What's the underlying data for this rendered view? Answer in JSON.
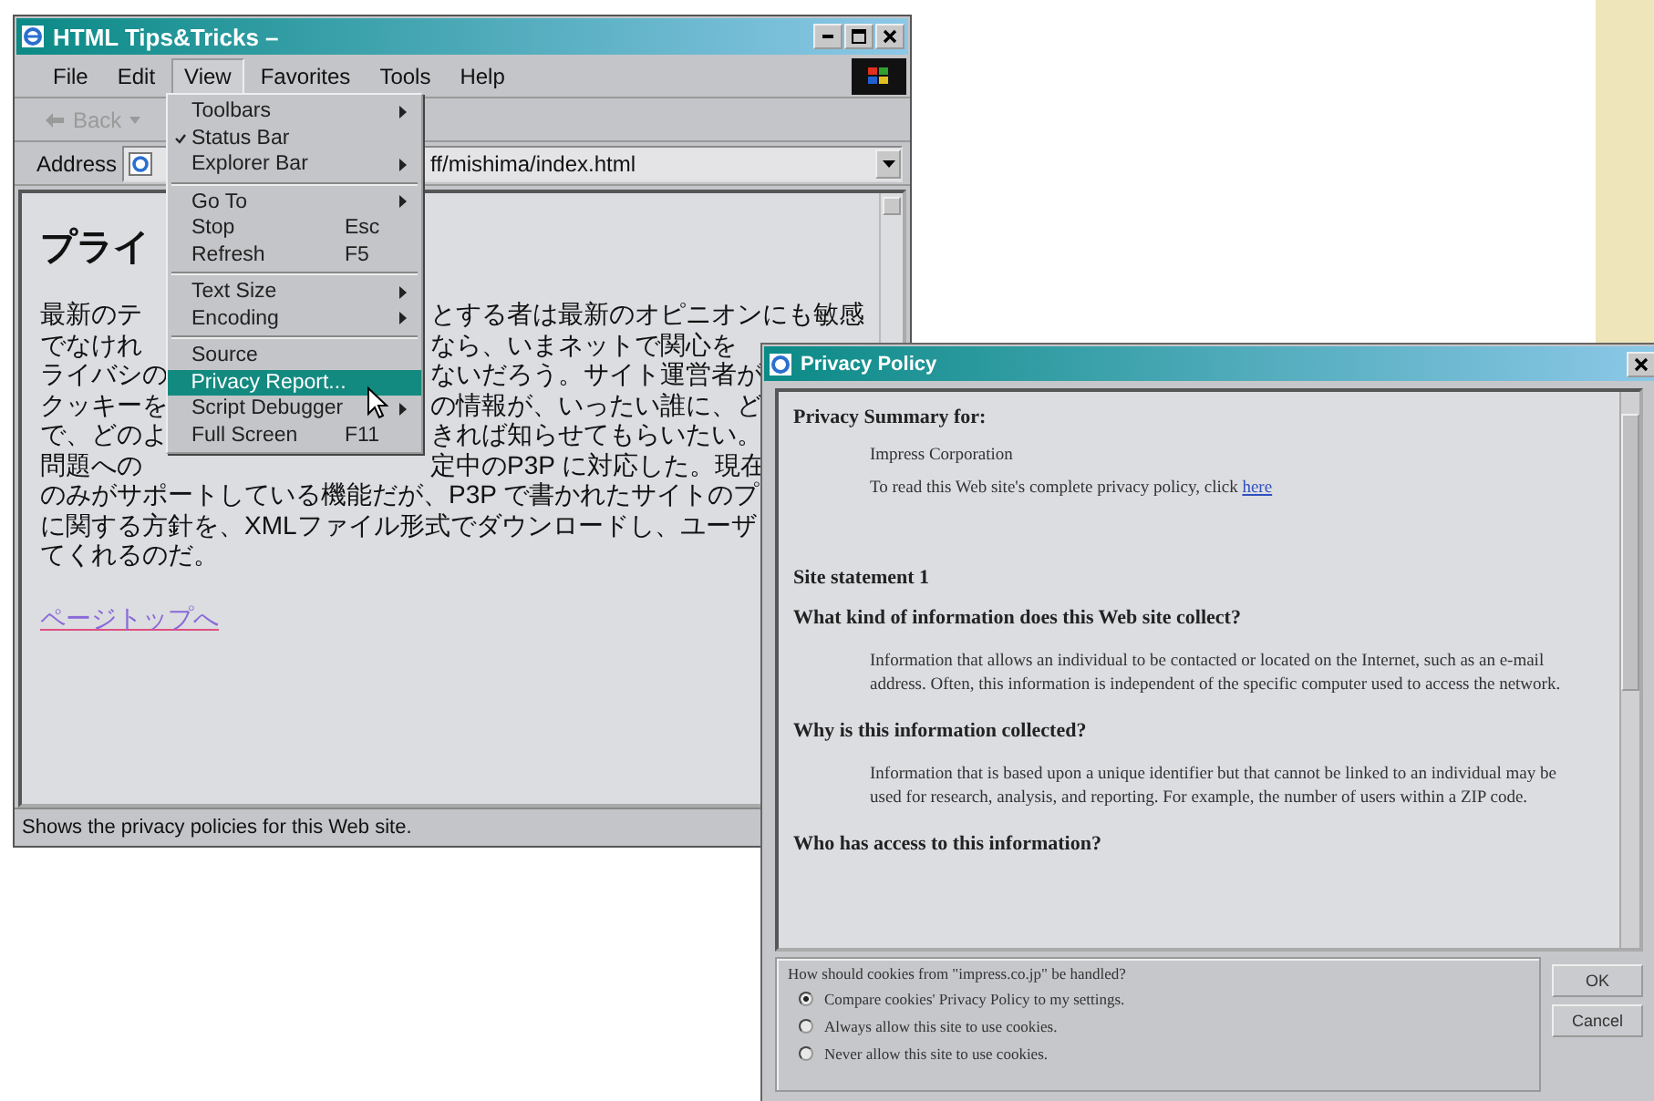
{
  "browser_window": {
    "title": "HTML Tips&Tricks –",
    "menu_bar": [
      {
        "label": "File",
        "selected": false
      },
      {
        "label": "Edit",
        "selected": false
      },
      {
        "label": "View",
        "selected": true
      },
      {
        "label": "Favorites",
        "selected": false
      },
      {
        "label": "Tools",
        "selected": false
      },
      {
        "label": "Help",
        "selected": false
      }
    ],
    "toolbar": {
      "back_label": "Back",
      "disabled": true
    },
    "address": {
      "label": "Address",
      "value": "ff/mishima/index.html"
    },
    "view_menu": [
      [
        {
          "label": "Toolbars",
          "submenu": true,
          "checked": false,
          "selected": false
        },
        {
          "label": "Status Bar",
          "submenu": false,
          "checked": true,
          "selected": false
        },
        {
          "label": "Explorer Bar",
          "submenu": true,
          "checked": false,
          "selected": false
        }
      ],
      [
        {
          "label": "Go To",
          "submenu": true,
          "checked": false,
          "selected": false
        },
        {
          "label": "Stop",
          "shortcut": "Esc",
          "submenu": false,
          "checked": false,
          "selected": false
        },
        {
          "label": "Refresh",
          "shortcut": "F5",
          "submenu": false,
          "checked": false,
          "selected": false
        }
      ],
      [
        {
          "label": "Text Size",
          "submenu": true,
          "checked": false,
          "selected": false
        },
        {
          "label": "Encoding",
          "submenu": true,
          "checked": false,
          "selected": false
        }
      ],
      [
        {
          "label": "Source",
          "submenu": false,
          "checked": false,
          "selected": false
        },
        {
          "label": "Privacy Report...",
          "submenu": false,
          "checked": false,
          "selected": true
        },
        {
          "label": "Script Debugger",
          "submenu": true,
          "checked": false,
          "selected": false
        },
        {
          "label": "Full Screen",
          "shortcut": "F11",
          "submenu": false,
          "checked": false,
          "selected": false
        }
      ]
    ],
    "page": {
      "heading": "プライ",
      "lines": [
        {
          "left": "最新のテ",
          "right": "とする者は最新のオピニオンにも敏感"
        },
        {
          "left": "でなけれ",
          "right": "なら、いまネットで関心を"
        },
        {
          "left": "ライバシの",
          "right": "ないだろう。サイト運営者が"
        },
        {
          "left": "クッキーを",
          "right": "の情報が、いったい誰に、ど"
        },
        {
          "left": "で、どのよ",
          "right": "きれば知らせてもらいたい。"
        },
        {
          "left": "問題への",
          "right": "定中のP3P に対応した。現在"
        },
        {
          "left": "のみがサポートしている機能だが、P3P で書かれたサイトのプ"
        },
        {
          "left": "に関する方針を、XMLファイル形式でダウンロードし、ユーザ"
        },
        {
          "left": "てくれるのだ。"
        }
      ],
      "link": "ページトップへ"
    },
    "status_bar": "Shows the privacy policies for this Web site."
  },
  "privacy_window": {
    "title": "Privacy Policy",
    "summary_heading": "Privacy Summary for:",
    "company": "Impress Corporation",
    "read_text": "To read this Web site's complete privacy policy, click",
    "read_link": "here",
    "statement": "Site statement 1",
    "sections": [
      {
        "question": "What kind of information does this Web site collect?",
        "answer": "Information that allows an individual to be contacted or located on the Internet, such as an e-mail address. Often, this information is independent of the specific computer used to access the network."
      },
      {
        "question": "Why is this information collected?",
        "answer": "Information that is based upon a unique identifier but that cannot be linked to an individual may be used for research, analysis, and reporting. For example, the number of users within a ZIP code."
      },
      {
        "question": "Who has access to this information?"
      }
    ],
    "cookie_prompt": "How should cookies from \"impress.co.jp\" be handled?",
    "cookie_options": [
      {
        "label": "Compare cookies' Privacy Policy to my settings.",
        "selected": true
      },
      {
        "label": "Always allow this site to use cookies.",
        "selected": false
      },
      {
        "label": "Never allow this site to use cookies.",
        "selected": false
      }
    ],
    "buttons": [
      "OK",
      "Cancel"
    ]
  }
}
